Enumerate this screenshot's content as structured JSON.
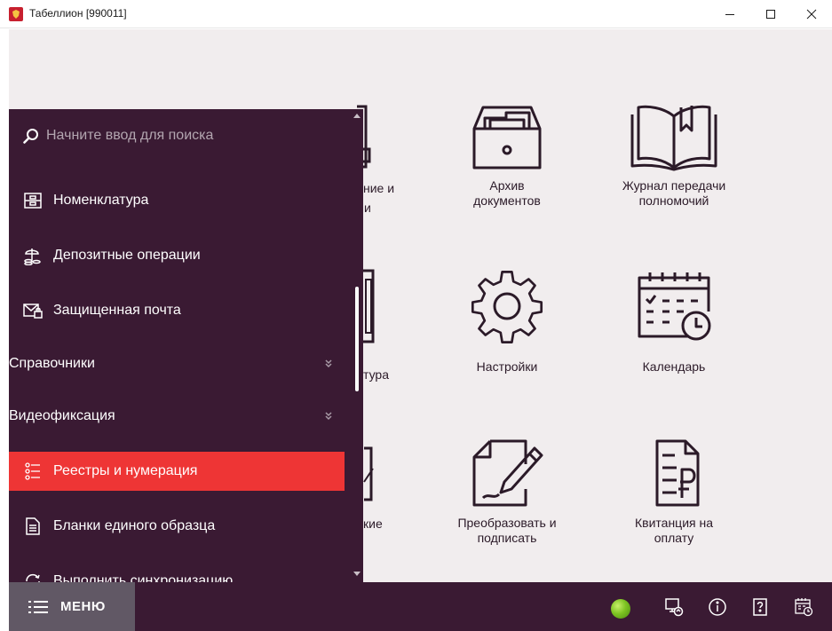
{
  "window": {
    "title": "Табеллион [990011]"
  },
  "tiles": [
    {
      "name": "archive",
      "label": "Архив\nдокументов",
      "icon": "archive-box-icon"
    },
    {
      "name": "power-of-attorney-log",
      "label": "Журнал передачи\nполномочий",
      "icon": "open-book-icon"
    },
    {
      "name": "settings",
      "label": "Настройки",
      "icon": "gear-icon"
    },
    {
      "name": "calendar",
      "label": "Календарь",
      "icon": "calendar-clock-icon"
    },
    {
      "name": "convert-sign",
      "label": "Преобразовать и\nподписать",
      "icon": "document-pen-icon"
    },
    {
      "name": "payment-receipt",
      "label": "Квитанция на\nоплату",
      "icon": "ruble-document-icon"
    }
  ],
  "partial_tiles": {
    "row1": "ние и",
    "row1b": "и",
    "row2": "тура",
    "row3": "кие"
  },
  "search": {
    "placeholder": "Начните ввод для поиска"
  },
  "menu": {
    "items": [
      {
        "label": "Номенклатура",
        "icon": "nomenclature-icon"
      },
      {
        "label": "Депозитные операции",
        "icon": "deposit-icon"
      },
      {
        "label": "Защищенная почта",
        "icon": "secure-mail-icon"
      }
    ],
    "groups": [
      {
        "label": "Справочники"
      },
      {
        "label": "Видеофиксация"
      }
    ],
    "items2": [
      {
        "label": "Реестры и нумерация",
        "icon": "registry-list-icon",
        "active": true
      },
      {
        "label": "Бланки единого образца",
        "icon": "form-document-icon"
      },
      {
        "label": "Выполнить синхронизацию",
        "icon": "sync-icon"
      }
    ]
  },
  "bottombar": {
    "menu_label": "МЕНЮ"
  },
  "colors": {
    "sidebar_bg": "#3a1a33",
    "active_item": "#ee3535",
    "main_bg": "#f1edee",
    "icon_stroke": "#2b1a28"
  }
}
